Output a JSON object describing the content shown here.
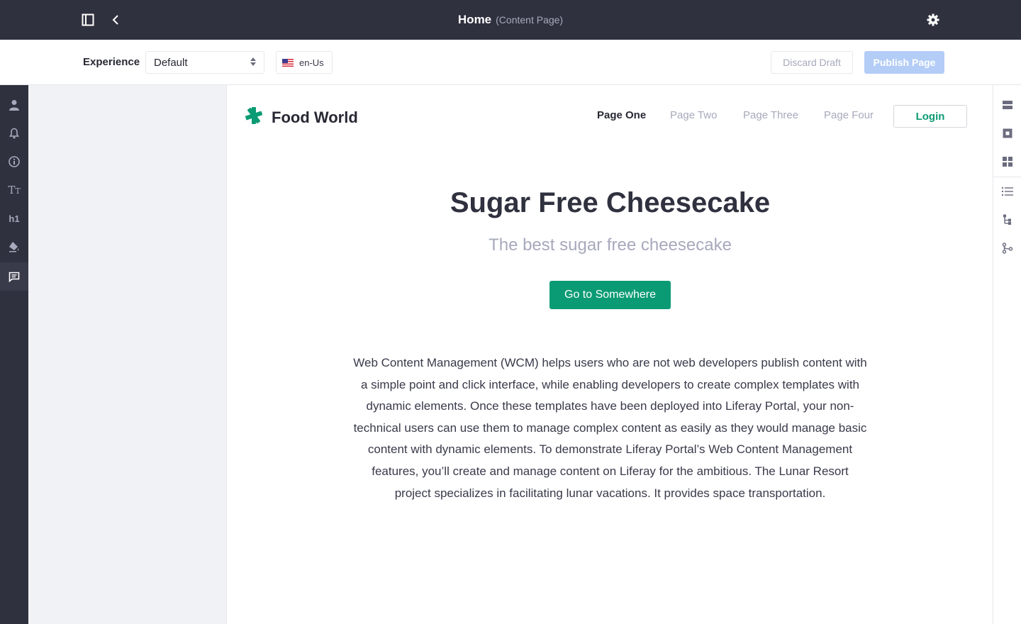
{
  "topbar": {
    "title": "Home",
    "subtitle": "(Content Page)",
    "icons": {
      "sidebar_toggle": "sidebar-toggle-icon",
      "back": "chevron-left-icon",
      "settings": "gear-icon"
    }
  },
  "toolbar": {
    "experience_label": "Experience",
    "experience_value": "Default",
    "language_label": "en-Us",
    "discard_label": "Discard Draft",
    "publish_label": "Publish Page"
  },
  "left_rail": {
    "items": [
      "user-icon",
      "bell-icon",
      "info-icon",
      "typography-icon",
      "heading-icon",
      "paint-bucket-icon",
      "comments-icon"
    ],
    "active": "comments-icon"
  },
  "right_rail": {
    "items": [
      "section-layout-icon",
      "square-fragment-icon",
      "widgets-icon",
      "list-icon",
      "page-structure-icon",
      "branch-icon"
    ]
  },
  "site": {
    "brand": "Food World",
    "nav": [
      "Page One",
      "Page Two",
      "Page Three",
      "Page Four"
    ],
    "nav_active": "Page One",
    "login": "Login"
  },
  "hero": {
    "title": "Sugar Free Cheesecake",
    "subtitle": "The best sugar free cheesecake",
    "cta": "Go to Somewhere"
  },
  "content": {
    "paragraph": "Web Content Management (WCM) helps users who are not web developers publish content with a simple point and click interface, while enabling developers to create complex templates with dynamic elements. Once these templates have been deployed into Liferay Portal, your non-technical users can use them to manage complex content as easily as they would manage basic content with dynamic elements. To demonstrate Liferay Portal’s Web Content Management features, you’ll create and manage content on Liferay for the ambitious. The Lunar Resort project specializes in facilitating lunar vacations. It provides space transportation."
  },
  "colors": {
    "topbar": "#30313f",
    "accent_green": "#0b9b74",
    "publish_disabled": "#b3cdf7",
    "panel_bg": "#f1f2f5"
  }
}
